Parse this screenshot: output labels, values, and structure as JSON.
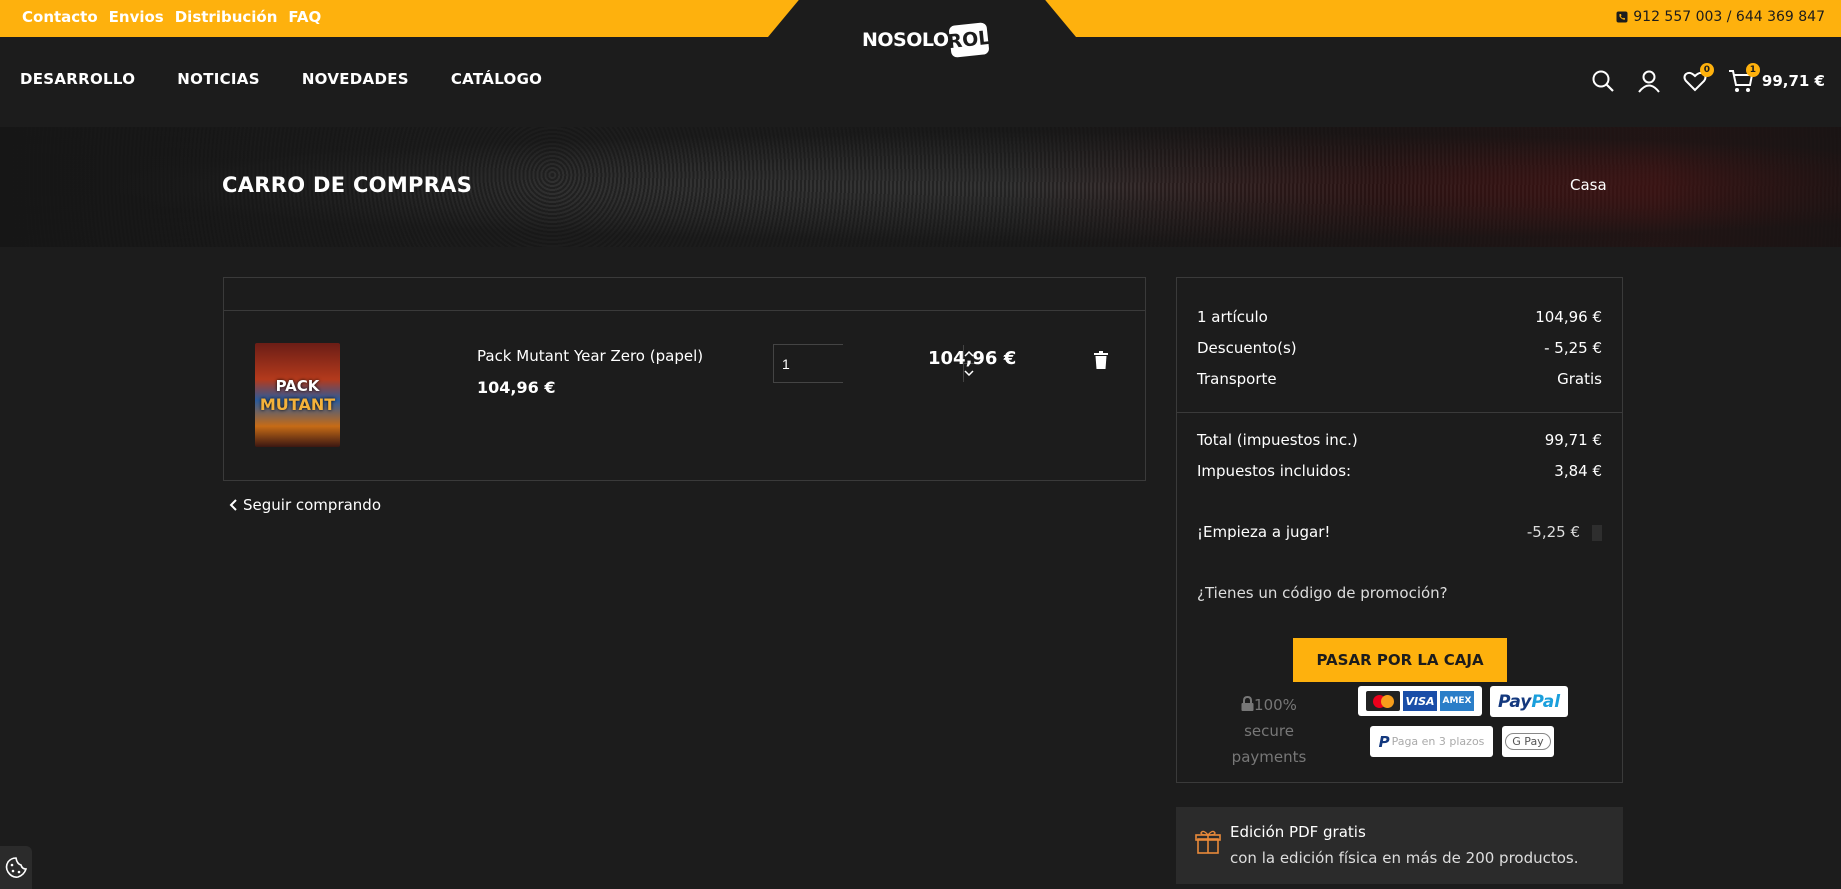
{
  "topbar": {
    "links": [
      "Contacto",
      "Envios",
      "Distribución",
      "FAQ"
    ],
    "phone": "912 557 003 / 644 369 847"
  },
  "logo": {
    "text": "NOSOLO",
    "die": "ROL"
  },
  "nav": [
    "DESARROLLO",
    "NOTICIAS",
    "NOVEDADES",
    "CATÁLOGO"
  ],
  "header": {
    "wishlist_count": "0",
    "cart_count": "1",
    "cart_total": "99,71 €"
  },
  "hero": {
    "title": "CARRO DE COMPRAS",
    "breadcrumb": "Casa"
  },
  "cart": {
    "item": {
      "thumb_line1": "PACK",
      "thumb_line2": "MUTANT",
      "name": "Pack Mutant Year Zero (papel)",
      "price": "104,96 €",
      "quantity": "1",
      "line_total": "104,96 €"
    },
    "continue_label": "Seguir comprando"
  },
  "summary": {
    "items_label": "1 artículo",
    "items_value": "104,96 €",
    "discount_label": "Descuento(s)",
    "discount_value": "- 5,25 €",
    "shipping_label": "Transporte",
    "shipping_value": "Gratis",
    "total_label": "Total (impuestos inc.)",
    "total_value": "99,71 €",
    "tax_label": "Impuestos incluidos:",
    "tax_value": "3,84 €",
    "promo_name": "¡Empieza a jugar!",
    "promo_value": "-5,25 €",
    "promo_question": "¿Tienes un código de promoción?",
    "checkout_label": "PASAR POR LA CAJA",
    "secure_text": "100% secure payments",
    "payment_logos": {
      "mastercard": "mastercard",
      "visa": "VISA",
      "amex": "AMEX",
      "paypal_a": "Pay",
      "paypal_b": "Pal",
      "paypal_installments": "Paga en 3 plazos",
      "gpay": "G Pay"
    }
  },
  "perk": {
    "title": "Edición PDF gratis",
    "subtitle": "con la edición física en más de 200 productos."
  },
  "colors": {
    "accent": "#feb10d",
    "background": "#1c1c1c"
  }
}
